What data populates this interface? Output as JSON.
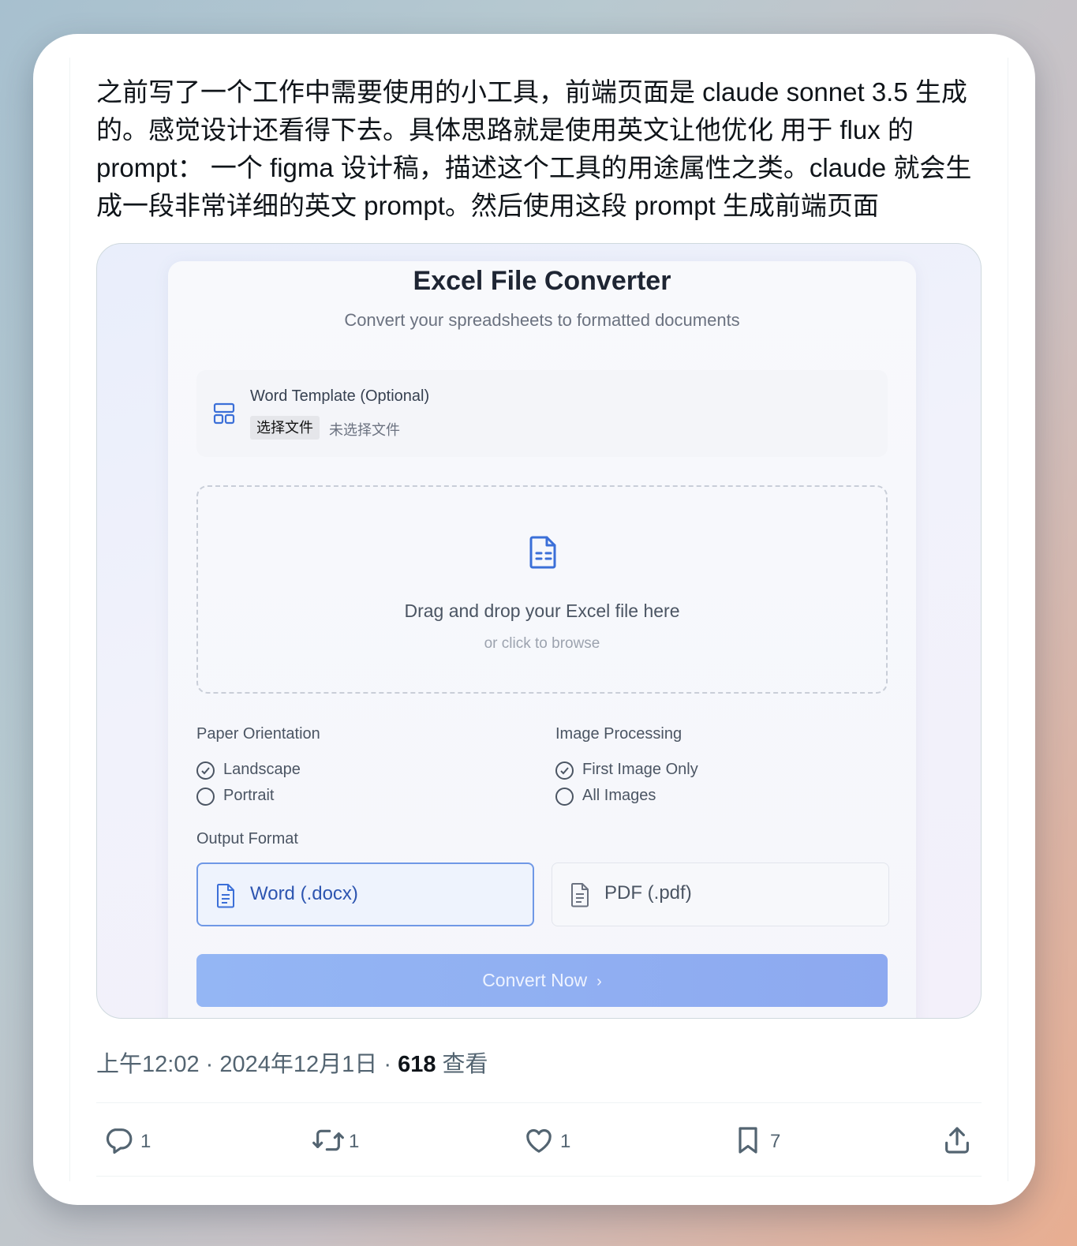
{
  "tweet": {
    "text": "之前写了一个工作中需要使用的小工具，前端页面是 claude sonnet 3.5 生成的。感觉设计还看得下去。具体思路就是使用英文让他优化 用于 flux 的 prompt： 一个 figma 设计稿，描述这个工具的用途属性之类。claude 就会生成一段非常详细的英文 prompt。然后使用这段 prompt 生成前端页面",
    "time": "上午12:02",
    "date": "2024年12月1日",
    "views": "618",
    "views_label": "查看",
    "separator": "·"
  },
  "app": {
    "title": "Excel File Converter",
    "subtitle": "Convert your spreadsheets to formatted documents",
    "template": {
      "label": "Word Template (Optional)",
      "button": "选择文件",
      "status": "未选择文件"
    },
    "dropzone": {
      "title": "Drag and drop your Excel file here",
      "subtitle": "or click to browse"
    },
    "orientation": {
      "label": "Paper Orientation",
      "options": [
        "Landscape",
        "Portrait"
      ],
      "selected": "Landscape"
    },
    "image_processing": {
      "label": "Image Processing",
      "options": [
        "First Image Only",
        "All Images"
      ],
      "selected": "First Image Only"
    },
    "output": {
      "label": "Output Format",
      "options": [
        "Word (.docx)",
        "PDF (.pdf)"
      ],
      "selected": "Word (.docx)"
    },
    "convert_label": "Convert Now",
    "convert_chevron": "›",
    "accent_color": "#2d55b0",
    "button_color": "#8da9f0"
  },
  "actions": {
    "replies": "1",
    "retweets": "1",
    "likes": "1",
    "bookmarks": "7"
  },
  "icons": [
    "reply-icon",
    "retweet-icon",
    "like-icon",
    "bookmark-icon",
    "share-icon",
    "template-icon",
    "document-icon",
    "check-icon"
  ]
}
